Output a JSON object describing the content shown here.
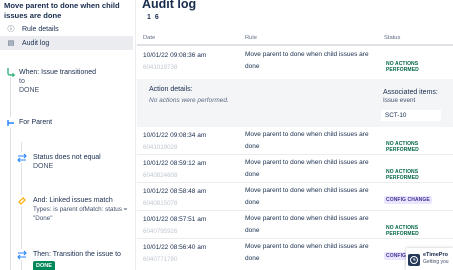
{
  "left": {
    "rule_title": "Move parent to done when child issues are done",
    "nav": [
      {
        "label": "Rule details",
        "icon": "info-icon"
      },
      {
        "label": "Audit log",
        "icon": "document-icon"
      }
    ],
    "trigger": {
      "title": "When: Issue transitioned",
      "line1": "to",
      "line2": "DONE"
    },
    "branch": {
      "title": "For Parent"
    },
    "condition1": {
      "title": "Status does not equal",
      "value": "DONE"
    },
    "condition2": {
      "title": "And: Linked issues match",
      "line1": "Types: is parent ofMatch: status =",
      "line2": "\"Done\""
    },
    "action": {
      "title": "Then: Transition the issue to",
      "lozenge": "DONE"
    }
  },
  "main": {
    "title": "Audit log",
    "pager": "1 6",
    "columns": {
      "date": "Date",
      "rule": "Rule",
      "status": "Status"
    },
    "rows": [
      {
        "date": "10/01/22 09:08:36 am",
        "id": "6041019738",
        "rule": "Move parent to done when child issues are done",
        "status": "NO ACTIONS PERFORMED",
        "kind": "none"
      },
      {
        "date": "10/01/22 09:08:34 am",
        "id": "6041019028",
        "rule": "Move parent to done when child issues are done",
        "status": "NO ACTIONS PERFORMED",
        "kind": "none"
      },
      {
        "date": "10/01/22 08:59:12 am",
        "id": "6040824608",
        "rule": "Move parent to done when child issues are done",
        "status": "NO ACTIONS PERFORMED",
        "kind": "none"
      },
      {
        "date": "10/01/22 08:58:48 am",
        "id": "6040815078",
        "rule": "Move parent to done when child issues are done",
        "status": "CONFIG CHANGE",
        "kind": "config"
      },
      {
        "date": "10/01/22 08:57:51 am",
        "id": "6040795926",
        "rule": "Move parent to done when child issues are done",
        "status": "NO ACTIONS PERFORMED",
        "kind": "none"
      },
      {
        "date": "10/01/22 08:56:40 am",
        "id": "6040771780",
        "rule": "Move parent to done when child issues are done",
        "status": "CONFIG",
        "kind": "config"
      }
    ],
    "details": {
      "label": "Action details:",
      "message": "No actions were performed.",
      "associated_label": "Associated items:",
      "event_type": "Issue event",
      "issue_key": "SCT-10"
    }
  },
  "toast": {
    "title": "eTimePro",
    "subtitle": "Getting you"
  },
  "colors": {
    "done_green": "#00875a",
    "no_action_text": "#006644",
    "config_bg": "#eae6ff",
    "config_text": "#403294"
  }
}
